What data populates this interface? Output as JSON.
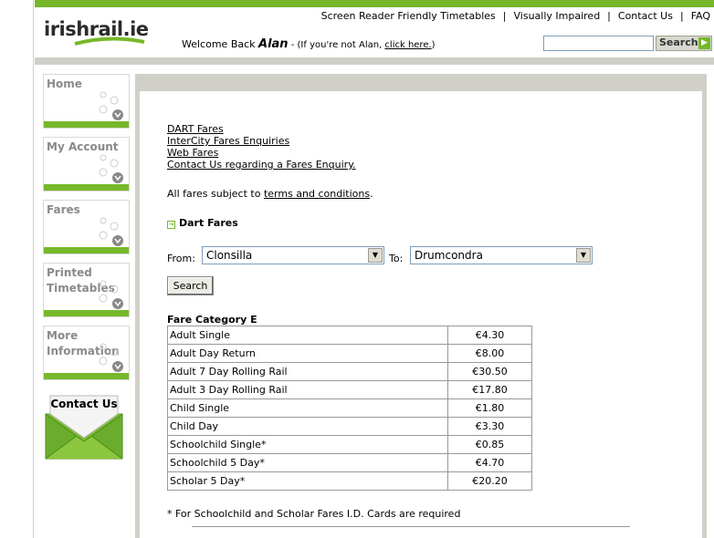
{
  "header": {
    "logo": "irishrail.ie",
    "links": [
      "Screen Reader Friendly Timetables",
      "Visually Impaired",
      "Contact Us",
      "FAQ"
    ],
    "welcome_prefix": "Welcome Back ",
    "user_name": "Alan",
    "welcome_suffix_pre": " - (If you're not Alan, ",
    "welcome_link": "click here.",
    "welcome_suffix_post": ")",
    "search_value": "",
    "search_button": "Search",
    "accent_color": "#76b82a"
  },
  "sidebar": {
    "items": [
      {
        "label": "Home"
      },
      {
        "label": "My Account"
      },
      {
        "label": "Fares"
      },
      {
        "label": "Printed Timetables"
      },
      {
        "label": "More Information"
      }
    ],
    "contact": "Contact Us"
  },
  "main": {
    "links": [
      "DART Fares",
      "InterCity Fares Enquiries",
      "Web Fares",
      "Contact Us regarding a Fares Enquiry."
    ],
    "terms_prefix": "All fares subject to ",
    "terms_link": "terms and conditions",
    "terms_suffix": ".",
    "section_title": "Dart Fares",
    "from_label": "From:",
    "from_value": "Clonsilla",
    "to_label": "To:",
    "to_value": "Drumcondra",
    "search_button": "Search",
    "fare_category": "Fare Category E",
    "fares": [
      {
        "type": "Adult Single",
        "price": "€4.30"
      },
      {
        "type": "Adult Day Return",
        "price": "€8.00"
      },
      {
        "type": "Adult 7 Day Rolling Rail",
        "price": "€30.50"
      },
      {
        "type": "Adult 3 Day Rolling Rail",
        "price": "€17.80"
      },
      {
        "type": "Child Single",
        "price": "€1.80"
      },
      {
        "type": "Child Day",
        "price": "€3.30"
      },
      {
        "type": "Schoolchild Single*",
        "price": "€0.85"
      },
      {
        "type": "Schoolchild 5 Day*",
        "price": "€4.70"
      },
      {
        "type": "Scholar 5 Day*",
        "price": "€20.20"
      }
    ],
    "footnote": "* For Schoolchild and Scholar Fares I.D. Cards are required"
  }
}
